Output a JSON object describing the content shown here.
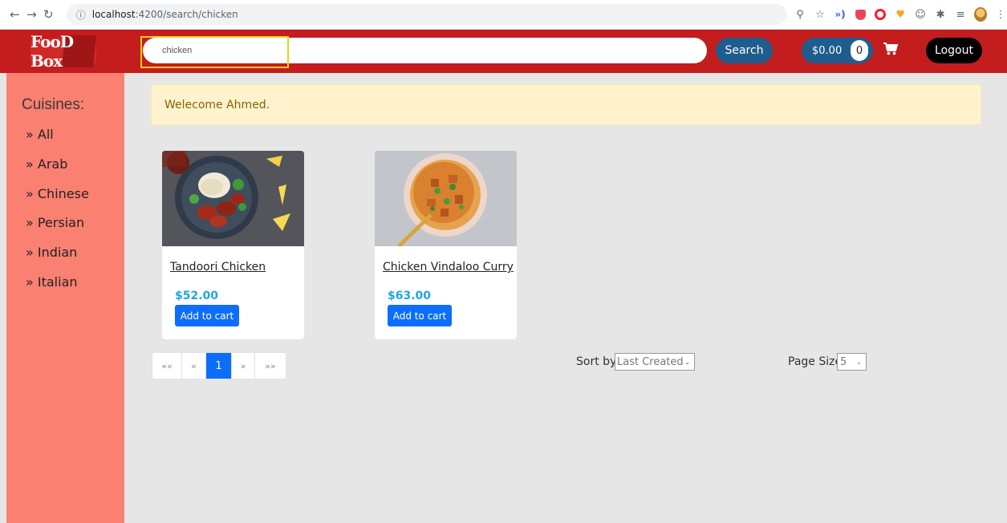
{
  "browser": {
    "url_host": "localhost",
    "url_path": ":4200/search/chicken",
    "icons": {
      "back": "arrow-left-icon",
      "forward": "arrow-right-icon",
      "reload": "reload-icon",
      "info": "info-icon",
      "zoom": "zoom-icon",
      "star": "star-icon",
      "menu": "kebab-menu-icon"
    }
  },
  "header": {
    "logo_text": "FooD Box",
    "search": {
      "value": "chicken",
      "placeholder": ""
    },
    "search_button": "Search",
    "cart": {
      "total": "$0.00",
      "count": "0"
    },
    "logout_button": "Logout",
    "colors": {
      "header_bg": "#c31d1d",
      "button_blue": "#1f5d8f",
      "highlight": "#f0d020"
    }
  },
  "sidebar": {
    "title": "Cuisines:",
    "items": [
      {
        "label": "» All"
      },
      {
        "label": "» Arab"
      },
      {
        "label": "» Chinese"
      },
      {
        "label": "» Persian"
      },
      {
        "label": "» Indian"
      },
      {
        "label": "» Italian"
      }
    ],
    "bg_color": "#fa8072"
  },
  "main": {
    "welcome_message": "Welecome Ahmed.",
    "products": [
      {
        "name": "Tandoori Chicken",
        "price": "$52.00",
        "button": "Add to cart"
      },
      {
        "name": "Chicken Vindaloo Curry",
        "price": "$63.00",
        "button": "Add to cart"
      }
    ],
    "pagination": {
      "first": "««",
      "prev": "«",
      "current": "1",
      "next": "»",
      "last": "»»"
    },
    "sort": {
      "label": "Sort by",
      "selected": "Last Created"
    },
    "page_size": {
      "label": "Page Size",
      "selected": "5"
    }
  }
}
